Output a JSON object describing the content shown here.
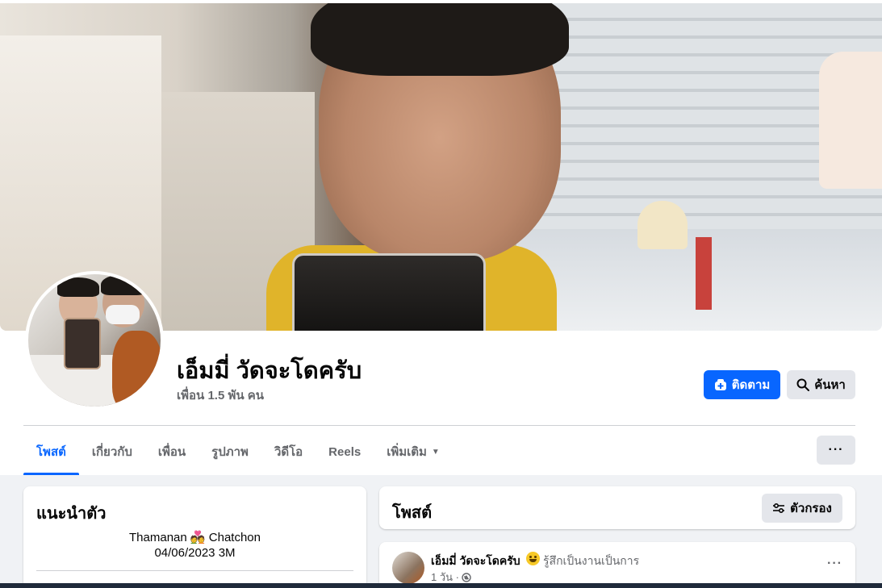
{
  "profile": {
    "name": "เอ็มมี่ วัดจะโดครับ",
    "friends": "เพื่อน 1.5 พัน คน"
  },
  "actions": {
    "follow_label": "ติดตาม",
    "search_label": "ค้นหา",
    "accent": "#0866ff"
  },
  "tabs": [
    {
      "label": "โพสต์",
      "active": true
    },
    {
      "label": "เกี่ยวกับ"
    },
    {
      "label": "เพื่อน"
    },
    {
      "label": "รูปภาพ"
    },
    {
      "label": "วิดีโอ"
    },
    {
      "label": "Reels"
    },
    {
      "label": "เพิ่มเติม"
    }
  ],
  "more_button": "···",
  "intro": {
    "title": "แนะนำตัว",
    "bio_line1_prefix": "Thamanan",
    "bio_line1_suffix": "Chatchon",
    "bio_line2": "04/06/2023 3M"
  },
  "posts": {
    "title": "โพสต์",
    "filter_label": "ตัวกรอง"
  },
  "post": {
    "author": "เอ็มมี่ วัดจะโดครับ",
    "feeling": "รู้สึกเป็นงานเป็นการ",
    "time": "1 วัน ·",
    "more": "···"
  }
}
